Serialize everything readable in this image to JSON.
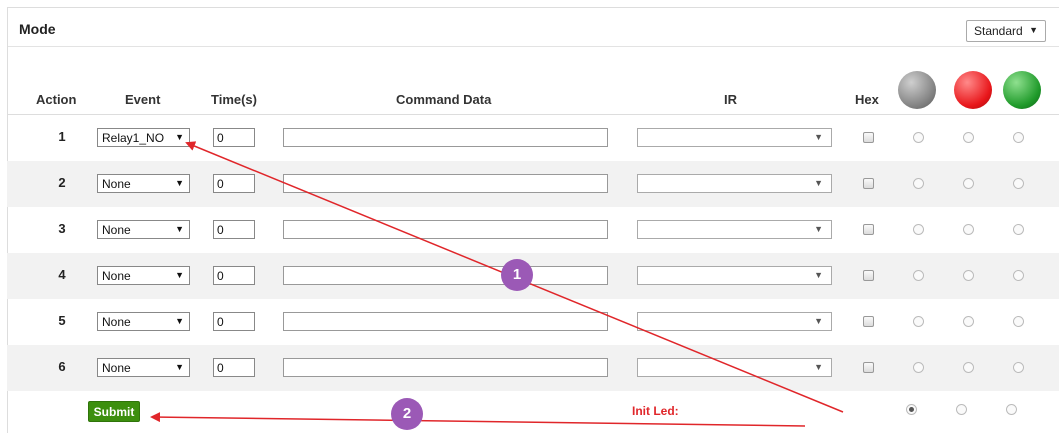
{
  "panel": {
    "title": "Mode",
    "mode_select": "Standard"
  },
  "columns": {
    "action": "Action",
    "event": "Event",
    "time": "Time(s)",
    "command": "Command Data",
    "ir": "IR",
    "hex": "Hex"
  },
  "rows": [
    {
      "action": "1",
      "event": "Relay1_NO",
      "time": "0",
      "command": ""
    },
    {
      "action": "2",
      "event": "None",
      "time": "0",
      "command": ""
    },
    {
      "action": "3",
      "event": "None",
      "time": "0",
      "command": ""
    },
    {
      "action": "4",
      "event": "None",
      "time": "0",
      "command": ""
    },
    {
      "action": "5",
      "event": "None",
      "time": "0",
      "command": ""
    },
    {
      "action": "6",
      "event": "None",
      "time": "0",
      "command": ""
    }
  ],
  "footer": {
    "submit_label": "Submit",
    "init_led_label": "Init Led:",
    "init_led_selected": "gray"
  },
  "leds": [
    {
      "name": "gray",
      "color": "#8a8a8a"
    },
    {
      "name": "red",
      "color": "#e8161a"
    },
    {
      "name": "green",
      "color": "#1f9a2a"
    }
  ],
  "annotations": {
    "badge1": "1",
    "badge2": "2",
    "color": "#9b59b6",
    "arrow_color": "#e0262a"
  }
}
